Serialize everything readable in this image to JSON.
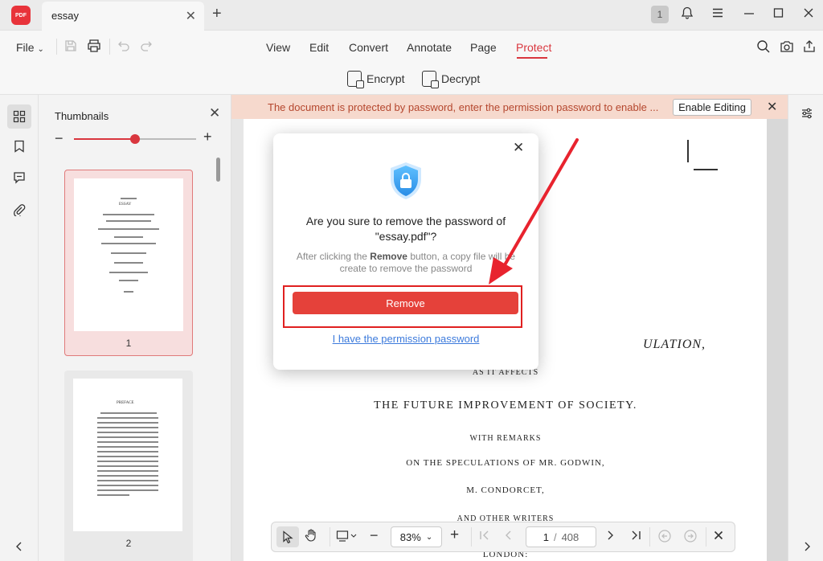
{
  "titlebar": {
    "logo_text": "PDF",
    "tab_title": "essay",
    "tab_close": "✕",
    "new_tab": "+",
    "notification_count": "1",
    "bell_icon": "bell-icon",
    "menu_icon": "hamburger-icon",
    "minimize_icon": "minimize-icon",
    "maximize_icon": "maximize-icon",
    "close_icon": "close-icon"
  },
  "menubar": {
    "file_label": "File",
    "tabs": [
      "View",
      "Edit",
      "Convert",
      "Annotate",
      "Page",
      "Protect"
    ],
    "active_tab": "Protect",
    "accent_color": "#d9363e"
  },
  "ribbon": {
    "encrypt_label": "Encrypt",
    "decrypt_label": "Decrypt"
  },
  "thumbnails": {
    "title": "Thumbnails",
    "pages": [
      {
        "number": "1",
        "selected": true,
        "heading": "ESSAY"
      },
      {
        "number": "2",
        "selected": false,
        "heading": "PREFACE"
      }
    ]
  },
  "notification": {
    "text": "The document is protected by password, enter the permission password to enable ...",
    "button_label": "Enable Editing",
    "close": "✕",
    "background_color": "#f6d9cd"
  },
  "document": {
    "lines": [
      "ULATION,",
      "AS IT AFFECTS",
      "THE FUTURE IMPROVEMENT OF SOCIETY.",
      "WITH REMARKS",
      "ON THE SPECULATIONS OF MR. GODWIN,",
      "M. CONDORCET,",
      "AND OTHER WRITERS",
      "LONDON:"
    ]
  },
  "bottombar": {
    "zoom": "83%",
    "current_page": "1",
    "page_separator": "/",
    "total_pages": "408"
  },
  "dialog": {
    "title_line1": "Are you sure to remove the password of",
    "title_line2": "\"essay.pdf\"?",
    "desc_prefix": "After clicking the ",
    "desc_bold": "Remove",
    "desc_suffix": " button, a copy file will be create to remove the password",
    "remove_label": "Remove",
    "permission_link": "I have the permission password",
    "button_color": "#e5413a",
    "shield_color": "#3aa5ef"
  }
}
